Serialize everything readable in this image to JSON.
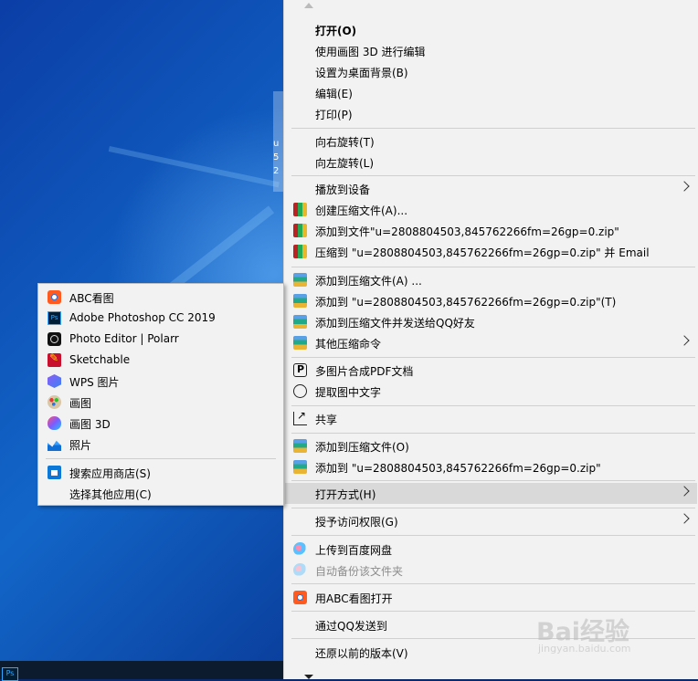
{
  "desktop": {
    "file_partial_text": "u\n5\n2",
    "taskbar_icon": "photoshop-icon"
  },
  "context_menu": {
    "groups": [
      [
        {
          "label": "打开(O)",
          "bold": true
        },
        {
          "label": "使用画图 3D 进行编辑"
        },
        {
          "label": "设置为桌面背景(B)"
        },
        {
          "label": "编辑(E)"
        },
        {
          "label": "打印(P)"
        }
      ],
      [
        {
          "label": "向右旋转(T)"
        },
        {
          "label": "向左旋转(L)"
        }
      ],
      [
        {
          "label": "播放到设备",
          "submenu": true
        },
        {
          "label": "创建压缩文件(A)...",
          "icon": "winrar-icon"
        },
        {
          "label": "添加到文件\"u=2808804503,845762266fm=26gp=0.zip\"",
          "icon": "winrar-icon"
        },
        {
          "label": "压缩到 \"u=2808804503,845762266fm=26gp=0.zip\" 并 Email",
          "icon": "winrar-icon"
        }
      ],
      [
        {
          "label": "添加到压缩文件(A) ...",
          "icon": "archive-icon"
        },
        {
          "label": "添加到 \"u=2808804503,845762266fm=26gp=0.zip\"(T)",
          "icon": "archive-icon"
        },
        {
          "label": "添加到压缩文件并发送给QQ好友",
          "icon": "archive-icon"
        },
        {
          "label": "其他压缩命令",
          "icon": "archive-icon",
          "submenu": true
        }
      ],
      [
        {
          "label": "多图片合成PDF文档",
          "icon": "pdf-icon"
        },
        {
          "label": "提取图中文字",
          "icon": "ocr-icon"
        }
      ],
      [
        {
          "label": "共享",
          "icon": "share-icon"
        }
      ],
      [
        {
          "label": "添加到压缩文件(O)",
          "icon": "archive-icon"
        },
        {
          "label": "添加到 \"u=2808804503,845762266fm=26gp=0.zip\"",
          "icon": "archive-icon"
        }
      ],
      [
        {
          "label": "打开方式(H)",
          "submenu": true,
          "highlighted": true
        }
      ],
      [
        {
          "label": "授予访问权限(G)",
          "submenu": true
        }
      ],
      [
        {
          "label": "上传到百度网盘",
          "icon": "baidu-netdisk-icon"
        },
        {
          "label": "自动备份该文件夹",
          "icon": "baidu-netdisk-icon",
          "disabled": true
        }
      ],
      [
        {
          "label": "用ABC看图打开",
          "icon": "abc-viewer-icon"
        }
      ],
      [
        {
          "label": "通过QQ发送到"
        }
      ],
      [
        {
          "label": "还原以前的版本(V)"
        }
      ]
    ]
  },
  "open_with_submenu": {
    "apps": [
      {
        "label": "ABC看图",
        "icon": "abc-viewer-icon"
      },
      {
        "label": "Adobe Photoshop CC 2019",
        "icon": "photoshop-icon"
      },
      {
        "label": "Photo Editor | Polarr",
        "icon": "polarr-icon"
      },
      {
        "label": "Sketchable",
        "icon": "sketchable-icon"
      },
      {
        "label": "WPS 图片",
        "icon": "wps-icon"
      },
      {
        "label": "画图",
        "icon": "paint-icon"
      },
      {
        "label": "画图 3D",
        "icon": "paint3d-icon"
      },
      {
        "label": "照片",
        "icon": "photos-icon"
      }
    ],
    "store_label": "搜索应用商店(S)",
    "store_icon": "store-icon",
    "choose_other_label": "选择其他应用(C)"
  },
  "watermark": {
    "text": "Bai经验",
    "subtext": "jingyan.baidu.com"
  }
}
